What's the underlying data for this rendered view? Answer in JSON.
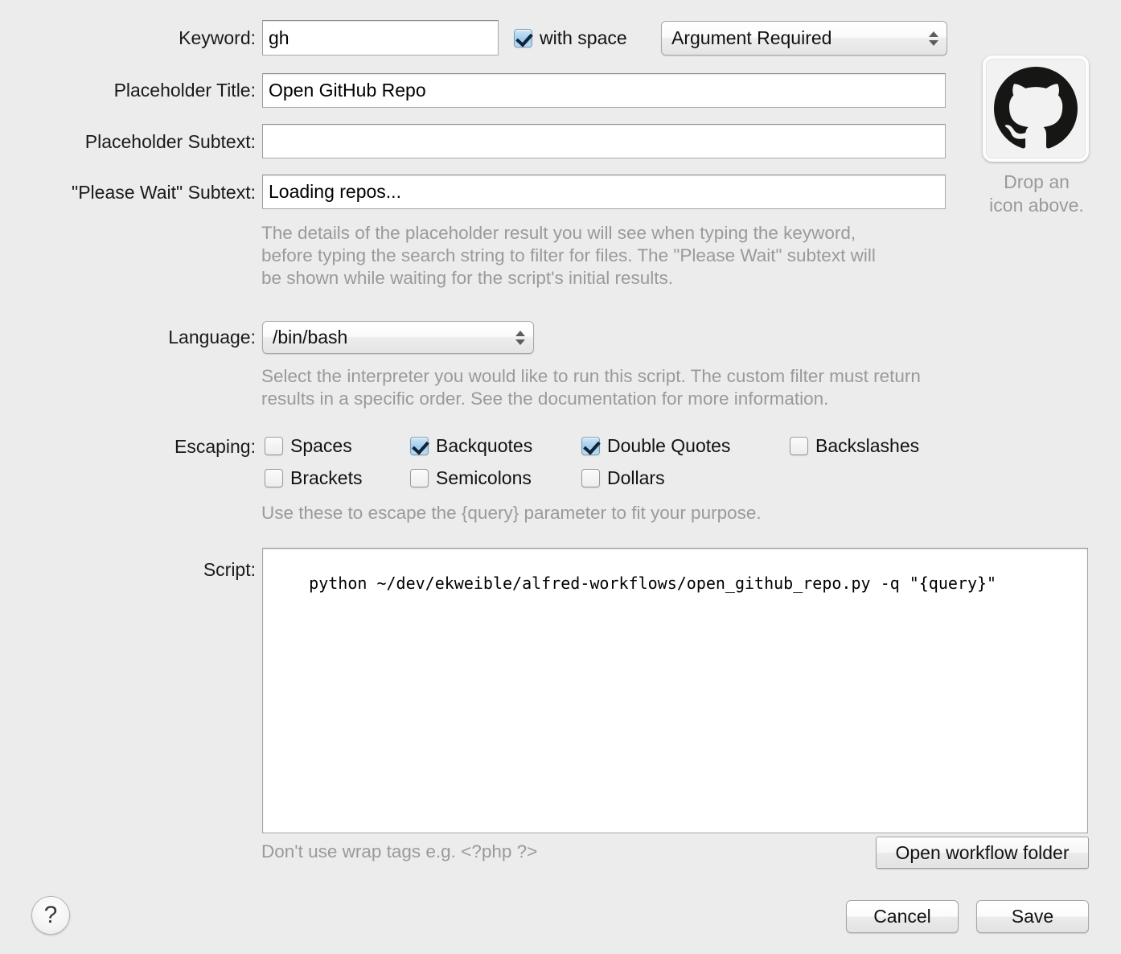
{
  "fields": {
    "keyword": {
      "label": "Keyword:",
      "value": "gh",
      "placeholder": "",
      "with_space_label": "with space",
      "with_space_checked": true,
      "argument_mode": "Argument Required"
    },
    "placeholder_title": {
      "label": "Placeholder Title:",
      "value": "Open GitHub Repo",
      "placeholder": ""
    },
    "placeholder_subtext": {
      "label": "Placeholder Subtext:",
      "value": "",
      "placeholder": ""
    },
    "please_wait_subtext": {
      "label": "\"Please Wait\" Subtext:",
      "value": "Loading repos...",
      "placeholder": ""
    }
  },
  "hints": {
    "placeholder_help": "The details of the placeholder result you will see when typing the keyword, before typing the search string to filter for files. The \"Please Wait\" subtext will be shown while waiting for the script's initial results.",
    "language_help": "Select the interpreter you would like to run this script. The custom filter must return results in a specific order. See the documentation for more information.",
    "escaping_help": "Use these to escape the {query} parameter to fit your purpose.",
    "wrap_tags_help": "Don't use wrap tags e.g. <?php ?>"
  },
  "icon_well": {
    "icon_name": "github-octocat-icon",
    "caption_line_1": "Drop an",
    "caption_line_2": "icon above."
  },
  "language": {
    "label": "Language:",
    "selected": "/bin/bash"
  },
  "escaping": {
    "label": "Escaping:",
    "options": [
      {
        "label": "Spaces",
        "checked": false
      },
      {
        "label": "Backquotes",
        "checked": true
      },
      {
        "label": "Double Quotes",
        "checked": true
      },
      {
        "label": "Backslashes",
        "checked": false
      },
      {
        "label": "Brackets",
        "checked": false
      },
      {
        "label": "Semicolons",
        "checked": false
      },
      {
        "label": "Dollars",
        "checked": false
      }
    ]
  },
  "script": {
    "label": "Script:",
    "value": "python ~/dev/ekweible/alfred-workflows/open_github_repo.py -q \"{query}\""
  },
  "buttons": {
    "open_workflow_folder": "Open workflow folder",
    "cancel": "Cancel",
    "save": "Save",
    "help": "?"
  },
  "colors": {
    "window_background": "#ececec",
    "field_background": "#ffffff",
    "hint_text": "#9a9a9a",
    "label_text": "#1a1a1a",
    "checkbox_accent": "#9fccec"
  }
}
